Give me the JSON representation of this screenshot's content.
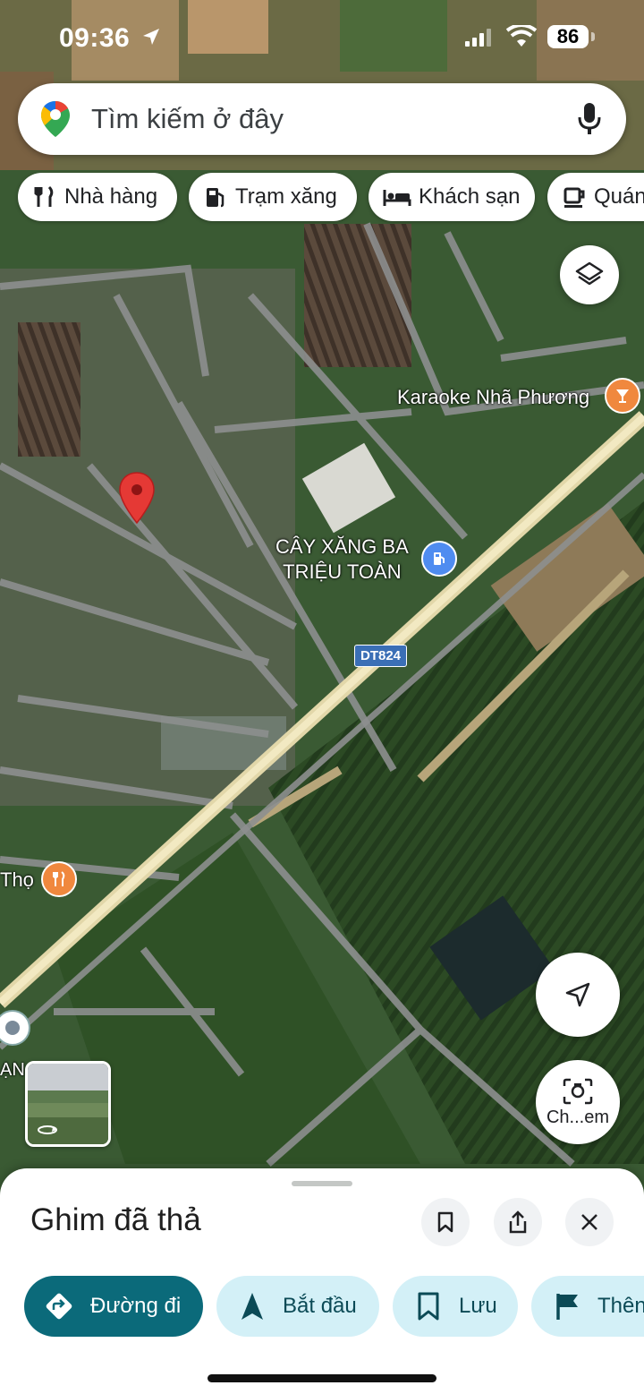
{
  "status_bar": {
    "time": "09:36",
    "battery": "86"
  },
  "search": {
    "placeholder": "Tìm kiếm ở đây"
  },
  "chips": [
    {
      "label": "Nhà hàng",
      "icon": "restaurant-icon"
    },
    {
      "label": "Trạm xăng",
      "icon": "gas-station-icon"
    },
    {
      "label": "Khách sạn",
      "icon": "hotel-icon"
    },
    {
      "label": "Quán",
      "icon": "cafe-icon"
    }
  ],
  "map": {
    "labels": {
      "karaoke": "Karaoke Nhã Phương",
      "gas_line1": "CÂY XĂNG BA",
      "gas_line2": "TRIỆU TOÀN",
      "road": "DT824",
      "left_place": "Thọ",
      "left_edge": "ẠN"
    }
  },
  "lens_label": "Ch...em",
  "sheet": {
    "title": "Ghim đã thả",
    "actions": [
      {
        "label": "Đường đi",
        "icon": "directions-icon"
      },
      {
        "label": "Bắt đầu",
        "icon": "navigation-arrow-icon"
      },
      {
        "label": "Lưu",
        "icon": "bookmark-icon"
      },
      {
        "label": "Thên",
        "icon": "flag-icon"
      }
    ]
  },
  "colors": {
    "primary": "#0b6a7a",
    "secondary_bg": "#d3f0f7",
    "pin": "#e53935",
    "poi_orange": "#f0883e",
    "poi_blue": "#4f8cf0"
  }
}
